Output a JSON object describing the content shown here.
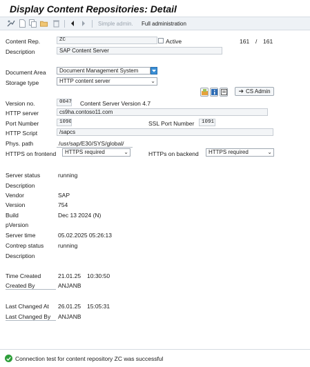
{
  "title": "Display Content Repositories: Detail",
  "toolbar": {
    "simple_admin": "Simple admin.",
    "full_admin": "Full administration"
  },
  "header": {
    "content_rep_label": "Content Rep.",
    "content_rep_value": "ZC",
    "active_label": "Active",
    "page_current": "161",
    "page_sep": "/",
    "page_total": "161",
    "description_label": "Description",
    "description_value": "SAP Content Server"
  },
  "settings": {
    "document_area_label": "Document Area",
    "document_area_value": "Document Management System",
    "storage_type_label": "Storage type",
    "storage_type_value": "HTTP content server",
    "cs_admin_button": "CS Admin",
    "version_no_label": "Version no.",
    "version_no_value": "0047",
    "version_text": "Content Server Version 4.7",
    "http_server_label": "HTTP server",
    "http_server_value": "cs9ha.contoso11.com",
    "port_number_label": "Port Number",
    "port_number_value": "1090",
    "ssl_port_label": "SSL Port Number",
    "ssl_port_value": "1091",
    "http_script_label": "HTTP Script",
    "http_script_value": "/sapcs",
    "phys_path_label": "Phys. path",
    "phys_path_value": "/usr/sap/E30/SYS/global/",
    "https_frontend_label": "HTTPS on frontend",
    "https_frontend_value": "HTTPS required",
    "https_backend_label": "HTTPs on backend",
    "https_backend_value": "HTTPS required"
  },
  "server": {
    "status_label": "Server status",
    "status_value": "running",
    "description_label": "Description",
    "vendor_label": "Vendor",
    "vendor_value": "SAP",
    "version_label": "Version",
    "version_value": "754",
    "build_label": "Build",
    "build_value": "Dec 13 2024 (N)",
    "pversion_label": "pVersion",
    "server_time_label": "Server time",
    "server_time_value": "05.02.2025 05:26:13",
    "contrep_status_label": "Contrep status",
    "contrep_status_value": "running",
    "description2_label": "Description"
  },
  "audit": {
    "time_created_label": "Time Created",
    "time_created_date": "21.01.25",
    "time_created_time": "10:30:50",
    "created_by_label": "Created By",
    "created_by_value": "ANJANB",
    "last_changed_at_label": "Last Changed At",
    "last_changed_date": "26.01.25",
    "last_changed_time": "15:05:31",
    "last_changed_by_label": "Last Changed By",
    "last_changed_by_value": "ANJANB"
  },
  "status_bar": {
    "message": "Connection test for content repository ZC was successful"
  },
  "colors": {
    "success": "#2e9e3a",
    "toolbar_bg": "#eef2f6",
    "field_bg": "#f3f5f7",
    "dropdown_accent": "#3a8fd6"
  }
}
